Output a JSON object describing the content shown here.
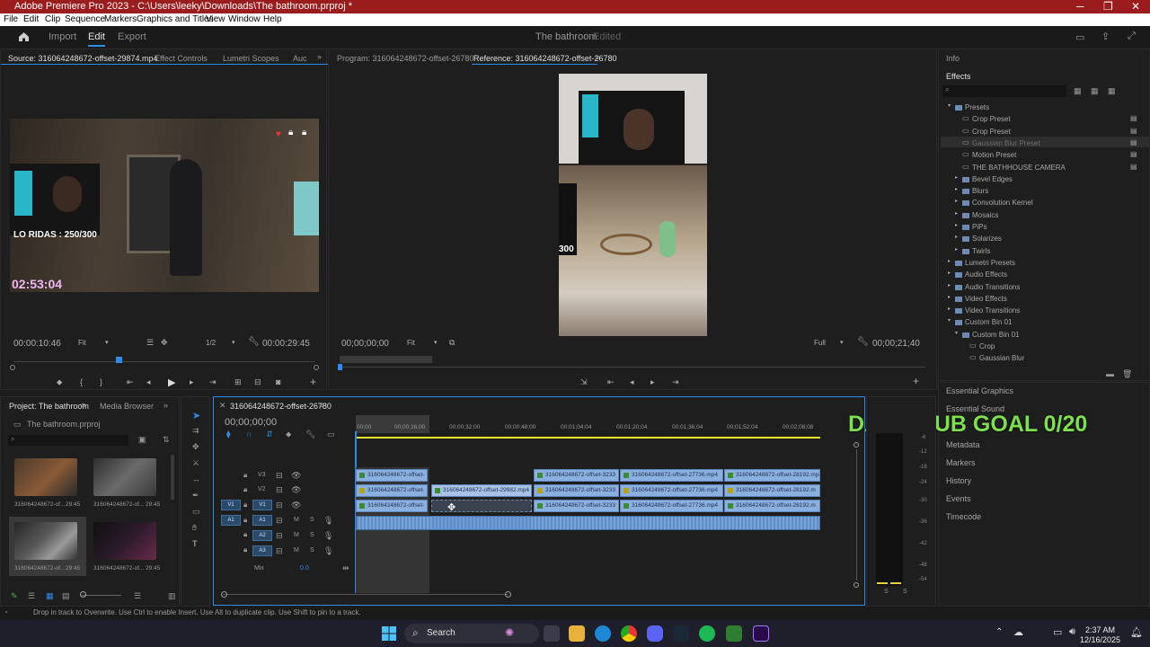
{
  "window": {
    "title": "Adobe Premiere Pro 2023 - C:\\Users\\leeky\\Downloads\\The bathroom.prproj *",
    "minimize": "─",
    "maximize": "❐",
    "close": "✕"
  },
  "menu": [
    "File",
    "Edit",
    "Clip",
    "Sequence",
    "Markers",
    "Graphics and Titles",
    "View",
    "Window",
    "Help"
  ],
  "workspace": {
    "tabs": [
      "Import",
      "Edit",
      "Export"
    ],
    "active_tab": "Edit",
    "project_name": "The bathroom",
    "project_state": "Edited"
  },
  "source": {
    "tabs": [
      "Source: 316064248672-offset-29874.mp4",
      "Effect Controls",
      "Lumetri Scopes",
      "Auc"
    ],
    "overlay_counter": "LO RIDAS : 250/300",
    "overlay_time": "02:53:04",
    "timecode": "00:00:10:46",
    "zoom": "Fit",
    "resolution": "1/2",
    "duration": "00:00:29:45"
  },
  "program": {
    "tab": "Program: 316064248672-offset-26780",
    "reference_tab": "Reference: 316064248672-offset-26780",
    "timecode": "00;00;00;00",
    "zoom": "Fit",
    "quality": "Full",
    "duration": "00;00;21;40",
    "frame_text": "300"
  },
  "project": {
    "tabs": [
      "Project: The bathroom",
      "Media Browser"
    ],
    "file": "The bathroom.prproj",
    "items": [
      {
        "name": "316064248672-of...",
        "dur": "29:45"
      },
      {
        "name": "316064248672-of...",
        "dur": "29:45"
      },
      {
        "name": "316064248672-of...",
        "dur": "29:45"
      },
      {
        "name": "316064248672-of...",
        "dur": "29:45"
      }
    ]
  },
  "timeline": {
    "tab": "316064248672-offset-26780",
    "timecode": "00;00;00;00",
    "ruler": [
      "00;00",
      "00;00;16;00",
      "00;00;32;00",
      "00;00;48;00",
      "00;01;04;04",
      "00;01;20;04",
      "00;01;36;04",
      "00;01;52;04",
      "00;02;08;08"
    ],
    "tracks": {
      "v3": "V3",
      "v2": "V2",
      "v1": "V1",
      "a1": "A1",
      "a2": "A2",
      "a3": "A3",
      "mix": "Mix",
      "mix_value": "0.0",
      "v1_patch": "V1",
      "a1_patch": "A1"
    },
    "clips": {
      "v3_a": "316064248672-offset-",
      "v3_b": "316064248672-offset-3233",
      "v3_c": "316064248672-offset-27736.mp4",
      "v3_d": "316064248672-offset-28192.mp4",
      "v2_a": "316064248672-offset-",
      "v2_b": "316064248672-offset-29982.mp4",
      "v2_c": "316064248672-offset-3233",
      "v2_d": "316064248672-offset-27736.mp4",
      "v2_e": "316064248672-offset-28192.m",
      "v1_a": "316064248672-offset-",
      "v1_b": "316064248672-offset-3233",
      "v1_c": "316064248672-offset-27736.mp4",
      "v1_d": "316064248672-offset-28192.m"
    },
    "overlay_goal": "DAILY SUB GOAL 0/20"
  },
  "effects": {
    "info_tab": "Info",
    "tab": "Effects",
    "items": [
      {
        "label": "Presets",
        "level": 0,
        "kind": "folder",
        "open": true
      },
      {
        "label": "Crop Preset",
        "level": 1,
        "kind": "preset"
      },
      {
        "label": "Crop Preset",
        "level": 1,
        "kind": "preset"
      },
      {
        "label": "Gaussian Blur Preset",
        "level": 1,
        "kind": "preset",
        "selected": true
      },
      {
        "label": "Motion Preset",
        "level": 1,
        "kind": "preset"
      },
      {
        "label": "THE BATHHOUSE CAMERA",
        "level": 1,
        "kind": "preset"
      },
      {
        "label": "Bevel Edges",
        "level": 1,
        "kind": "folder"
      },
      {
        "label": "Blurs",
        "level": 1,
        "kind": "folder"
      },
      {
        "label": "Convolution Kernel",
        "level": 1,
        "kind": "folder"
      },
      {
        "label": "Mosaics",
        "level": 1,
        "kind": "folder"
      },
      {
        "label": "PiPs",
        "level": 1,
        "kind": "folder"
      },
      {
        "label": "Solarizes",
        "level": 1,
        "kind": "folder"
      },
      {
        "label": "Twirls",
        "level": 1,
        "kind": "folder"
      },
      {
        "label": "Lumetri Presets",
        "level": 0,
        "kind": "folder"
      },
      {
        "label": "Audio Effects",
        "level": 0,
        "kind": "folder"
      },
      {
        "label": "Audio Transitions",
        "level": 0,
        "kind": "folder"
      },
      {
        "label": "Video Effects",
        "level": 0,
        "kind": "folder"
      },
      {
        "label": "Video Transitions",
        "level": 0,
        "kind": "folder"
      },
      {
        "label": "Custom Bin 01",
        "level": 0,
        "kind": "folder",
        "open": true
      },
      {
        "label": "Custom Bin 01",
        "level": 1,
        "kind": "folder",
        "open": true
      },
      {
        "label": "Crop",
        "level": 2,
        "kind": "effect"
      },
      {
        "label": "Gaussian Blur",
        "level": 2,
        "kind": "effect"
      }
    ]
  },
  "side_panels": [
    "Essential Graphics",
    "Essential Sound",
    "Metadata",
    "Markers",
    "History",
    "Events",
    "Timecode"
  ],
  "meter_scale": [
    "-6",
    "-12",
    "-18",
    "-24",
    "-30",
    "-36",
    "-42",
    "-48",
    "-54"
  ],
  "meter_solo": [
    "S",
    "S"
  ],
  "status_bar": "Drop in track to Overwrite. Use Ctrl to enable Insert. Use Alt to duplicate clip. Use Shift to pin to a track.",
  "taskbar": {
    "search": "Search",
    "time": "2:37 AM",
    "date": "12/16/2025"
  },
  "colors": {
    "accent": "#2d8ceb",
    "title_bar": "#9a1c1c",
    "goal_text": "#7ee04a",
    "clip_video": "#8ab0e0",
    "clip_audio": "#5f8dc9"
  }
}
